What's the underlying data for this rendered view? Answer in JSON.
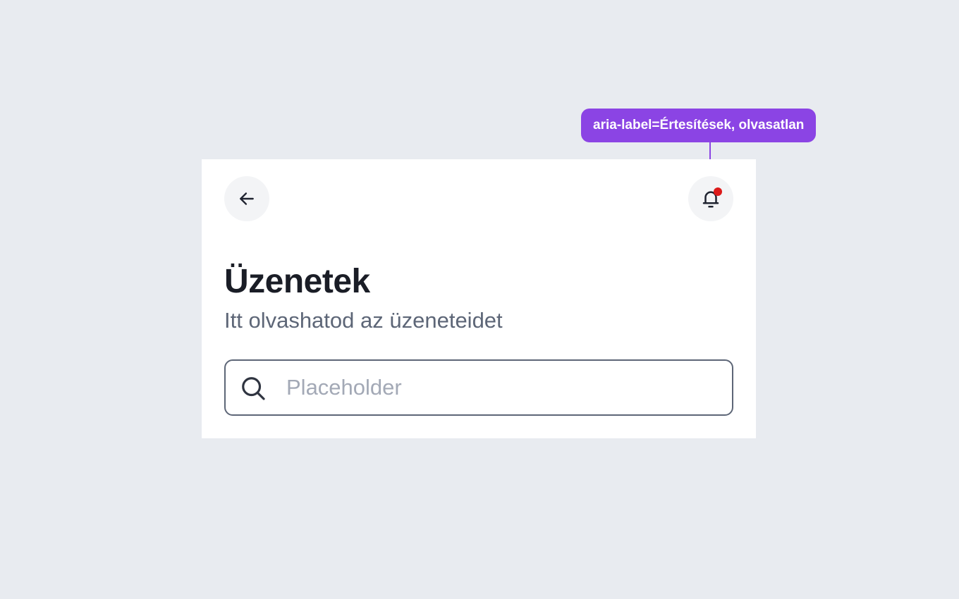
{
  "header": {
    "back_button_icon": "arrow-left-icon",
    "notification_button_icon": "bell-icon",
    "notification_unread": true,
    "unread_dot_color": "#dc1a1a"
  },
  "page": {
    "title": "Üzenetek",
    "subtitle": "Itt olvashatod az üzeneteidet"
  },
  "search": {
    "icon": "search-icon",
    "placeholder": "Placeholder",
    "value": ""
  },
  "annotation": {
    "label": "aria-label=Értesítések, olvasatlan",
    "color": "#8b44e4"
  }
}
